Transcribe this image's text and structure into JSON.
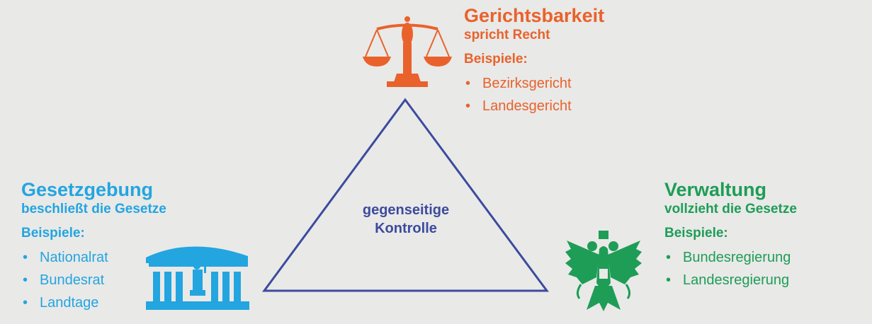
{
  "colors": {
    "court": "#e9622b",
    "legislature": "#23a5e0",
    "administration": "#1e9d56",
    "triangle": "#3c4b9d",
    "background": "#e9e9e8"
  },
  "court": {
    "title": "Gerichtsbarkeit",
    "subtitle": "spricht Recht",
    "examples_label": "Beispiele:",
    "examples": [
      "Bezirksgericht",
      "Landesgericht"
    ],
    "icon": "scales-of-justice-icon"
  },
  "legislature": {
    "title": "Gesetzgebung",
    "subtitle": "beschließt die Gesetze",
    "examples_label": "Beispiele:",
    "examples": [
      "Nationalrat",
      "Bundesrat",
      "Landtage"
    ],
    "icon": "parliament-building-icon"
  },
  "administration": {
    "title": "Verwaltung",
    "subtitle": "vollzieht die Gesetze",
    "examples_label": "Beispiele:",
    "examples": [
      "Bundesregierung",
      "Landesregierung"
    ],
    "icon": "eagle-coat-of-arms-icon"
  },
  "center": {
    "line1": "gegenseitige",
    "line2": "Kontrolle"
  }
}
